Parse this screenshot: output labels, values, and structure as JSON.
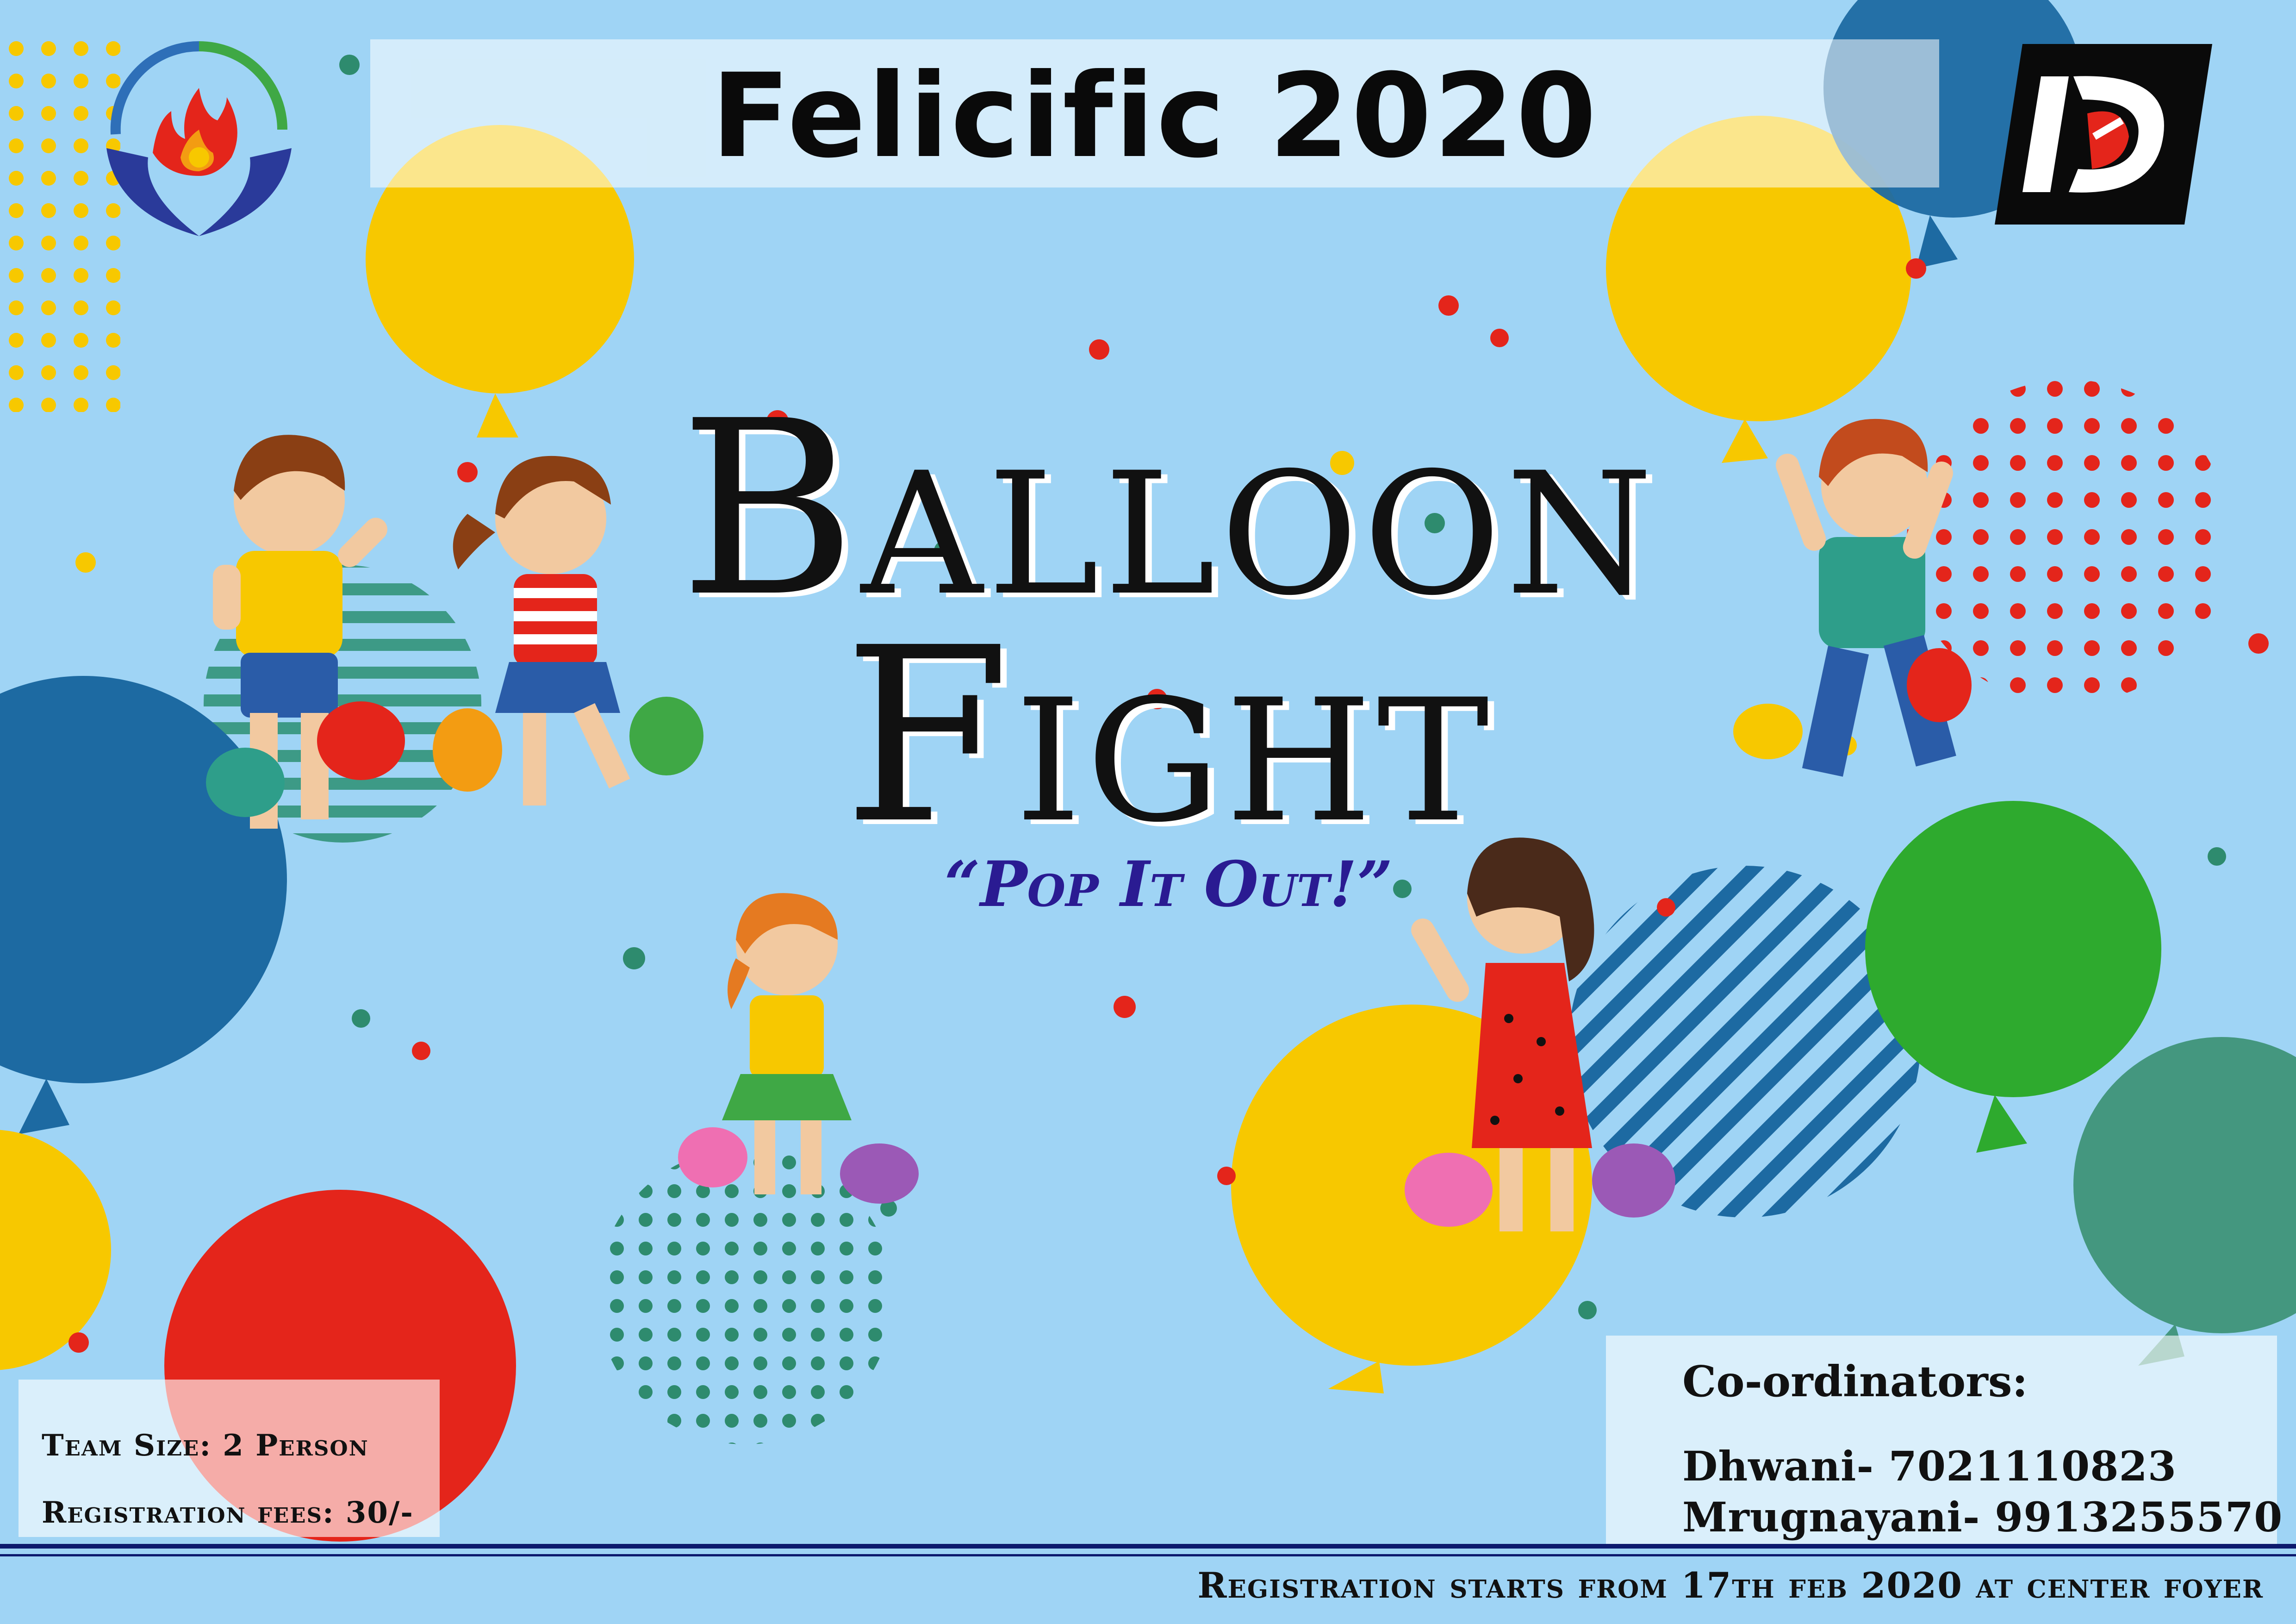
{
  "event": {
    "title": "Felicific 2020"
  },
  "headline": {
    "line1": "Balloon",
    "line2": "Fight",
    "tagline": "“Pop It Out!”"
  },
  "details": {
    "team_size": "Team Size: 2 Person",
    "registration_fees": "Registration fees: 30/-"
  },
  "coordinators": {
    "heading": "Co-ordinators:",
    "people": [
      "Dhwani- 7021110823",
      "Mrugnayani- 9913255570"
    ]
  },
  "footer": {
    "registration_note": "Registration starts from 17th feb 2020 at center foyer"
  },
  "colors": {
    "background": "#9fd4f5",
    "yellow_balloon": "#f7c800",
    "blue_balloon": "#1d6aa2",
    "red_balloon": "#e4251b",
    "green_balloon": "#2eaa2e",
    "teal_balloon": "#44977f",
    "tagline": "#2a1b92",
    "footer_rule": "#0d1a6e"
  },
  "icons": {
    "left_logo": "flame-hands-logo-icon",
    "right_logo": "d-monogram-logo-icon"
  }
}
